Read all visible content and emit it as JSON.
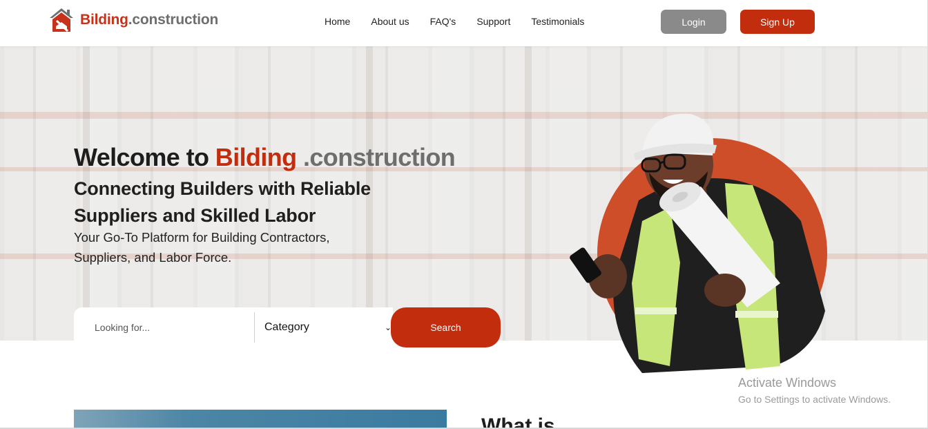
{
  "nav": {
    "logo_brand": "Bilding",
    "logo_rest": ".construction",
    "menu": [
      "Home",
      "About us",
      "FAQ's",
      "Support",
      "Testimonials"
    ],
    "login": "Login",
    "signup": "Sign Up"
  },
  "hero": {
    "title_prefix": "Welcome to",
    "title_brand": "Bilding",
    "title_rest": ".construction",
    "subtitle": "Connecting Builders with Reliable Suppliers and Skilled Labor",
    "tagline": "Your Go-To Platform for Building Contractors, Suppliers, and Labor Force."
  },
  "search": {
    "placeholder": "Looking for...",
    "category": "Category",
    "button": "Search"
  },
  "watermark": {
    "line1": "Activate Windows",
    "line2": "Go to Settings to activate Windows."
  },
  "below": {
    "title": "What is"
  },
  "colors": {
    "brand": "#c12d0d",
    "grey_button": "#8a8a8a",
    "circle": "#cf4e2a"
  }
}
